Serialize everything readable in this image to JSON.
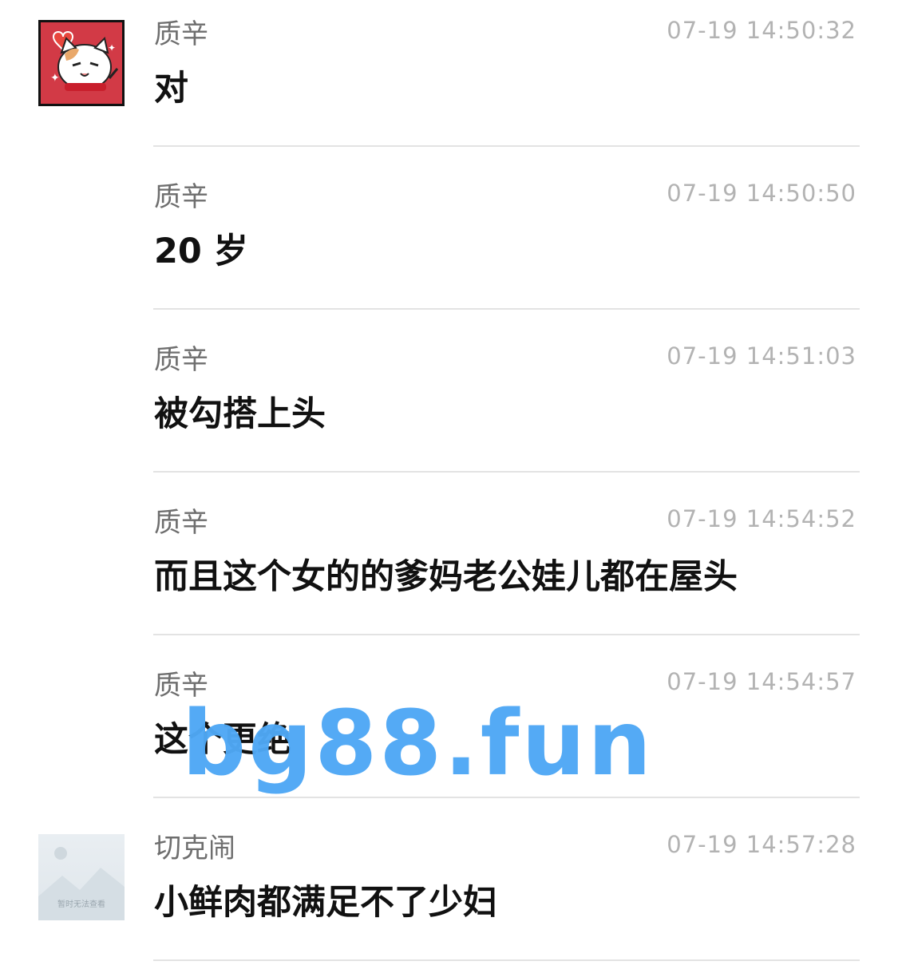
{
  "messages": [
    {
      "sender": "质辛",
      "time": "07-19 14:50:32",
      "text": "对",
      "avatar": "cat-sticker"
    },
    {
      "sender": "质辛",
      "time": "07-19 14:50:50",
      "text": "20 岁",
      "avatar": ""
    },
    {
      "sender": "质辛",
      "time": "07-19 14:51:03",
      "text": "被勾搭上头",
      "avatar": ""
    },
    {
      "sender": "质辛",
      "time": "07-19 14:54:52",
      "text": "而且这个女的的爹妈老公娃儿都在屋头",
      "avatar": ""
    },
    {
      "sender": "质辛",
      "time": "07-19 14:54:57",
      "text": "这个更绝",
      "avatar": ""
    },
    {
      "sender": "切克闹",
      "time": "07-19 14:57:28",
      "text": "小鲜肉都满足不了少妇",
      "avatar": "image-unavailable",
      "avatar_label": "暂时无法查看"
    }
  ],
  "watermark": "bg88.fun",
  "colors": {
    "watermark": "#4fa8f5",
    "avatar_bg": "#d23a46"
  }
}
